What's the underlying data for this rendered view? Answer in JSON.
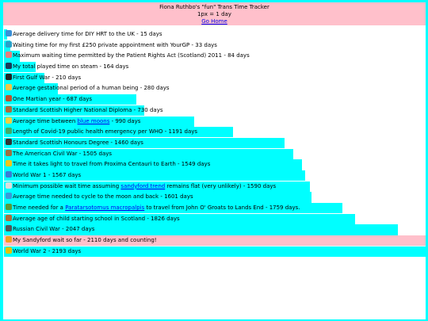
{
  "header": {
    "title": "Fiona Ruthbo's \"fun\" Trans Time Tracker",
    "scale": "1px = 1 day",
    "home_link": "Go Home"
  },
  "rows": [
    {
      "label": "Average delivery time for DIY HRT to the UK - 15 days",
      "days": 15,
      "icon": "tablet-icon",
      "color": "#3a8fd6"
    },
    {
      "label": "Waiting time for my first £250 private appointment with YourGP - 33 days",
      "days": 33,
      "icon": "syringe-icon",
      "color": "#2aa0c8"
    },
    {
      "label": "Maximum waiting time permitted by the Patient Rights Act (Scotland) 2011 - 84 days",
      "days": 84,
      "icon": "calendar-icon",
      "color": "#e87d7d"
    },
    {
      "label": "My total played time on steam - 164 days",
      "days": 164,
      "icon": "steam-icon",
      "color": "#1b3a5a"
    },
    {
      "label": "First Gulf War - 210 days",
      "days": 210,
      "icon": "flag-icon",
      "color": "#222222"
    },
    {
      "label": "Average gestational period of a human being - 280 days",
      "days": 280,
      "icon": "baby-icon",
      "color": "#f4c542"
    },
    {
      "label": "One Martian year - 687 days",
      "days": 687,
      "icon": "mars-icon",
      "color": "#c0502a"
    },
    {
      "label": "Standard Scottish Higher National Diploma - 730 days",
      "days": 730,
      "icon": "school-icon",
      "color": "#b06a3a"
    },
    {
      "label": "Average time between",
      "link": "blue moons",
      "suffix": " - 990 days",
      "days": 990,
      "icon": "moon-icon",
      "color": "#f4d03f"
    },
    {
      "label": "Length of Covid-19 public health emergency per WHO - 1191 days",
      "days": 1191,
      "icon": "virus-icon",
      "color": "#44aa66"
    },
    {
      "label": "Standard Scottish Honours Degree - 1460 days",
      "days": 1460,
      "icon": "graduation-icon",
      "color": "#333333"
    },
    {
      "label": "The American Civil War - 1505 days",
      "days": 1505,
      "icon": "cannon-icon",
      "color": "#a07040"
    },
    {
      "label": "Time it takes light to travel from Proxima Centauri to Earth - 1549 days",
      "days": 1549,
      "icon": "star-icon",
      "color": "#f5c518"
    },
    {
      "label": "World War 1 - 1567 days",
      "days": 1567,
      "icon": "globe-icon",
      "color": "#3a7bd5"
    },
    {
      "label": "Minimum possible wait time assuming",
      "link": "sandyford trend",
      "suffix": " remains flat (very unlikely) - 1590 days",
      "days": 1590,
      "icon": "skull-icon",
      "color": "#dddddd"
    },
    {
      "label": "Average time needed to cycle to the moon and back - 1601 days",
      "days": 1601,
      "icon": "bike-icon",
      "color": "#3a9ad9"
    },
    {
      "label": "Time needed for a",
      "link": "Paratarsotomus macropalpis",
      "suffix": " to travel from John O' Groats to Lands End - 1759 days.",
      "days": 1759,
      "icon": "mite-icon",
      "color": "#5a9a3a"
    },
    {
      "label": "Average age of child starting school in Scotland - 1826 days",
      "days": 1826,
      "icon": "school-bag-icon",
      "color": "#b06a3a"
    },
    {
      "label": "Russian Civil War - 2047 days",
      "days": 2047,
      "icon": "flag-icon",
      "color": "#555555"
    },
    {
      "label": "My Sandyford wait so far - 2110 days and counting!",
      "days": 2110,
      "icon": "angry-face-icon",
      "color": "#f4a020",
      "highlight": true
    },
    {
      "label": "World War 2 - 2193 days",
      "days": 2193,
      "icon": "radioactive-icon",
      "color": "#e6c200"
    }
  ]
}
